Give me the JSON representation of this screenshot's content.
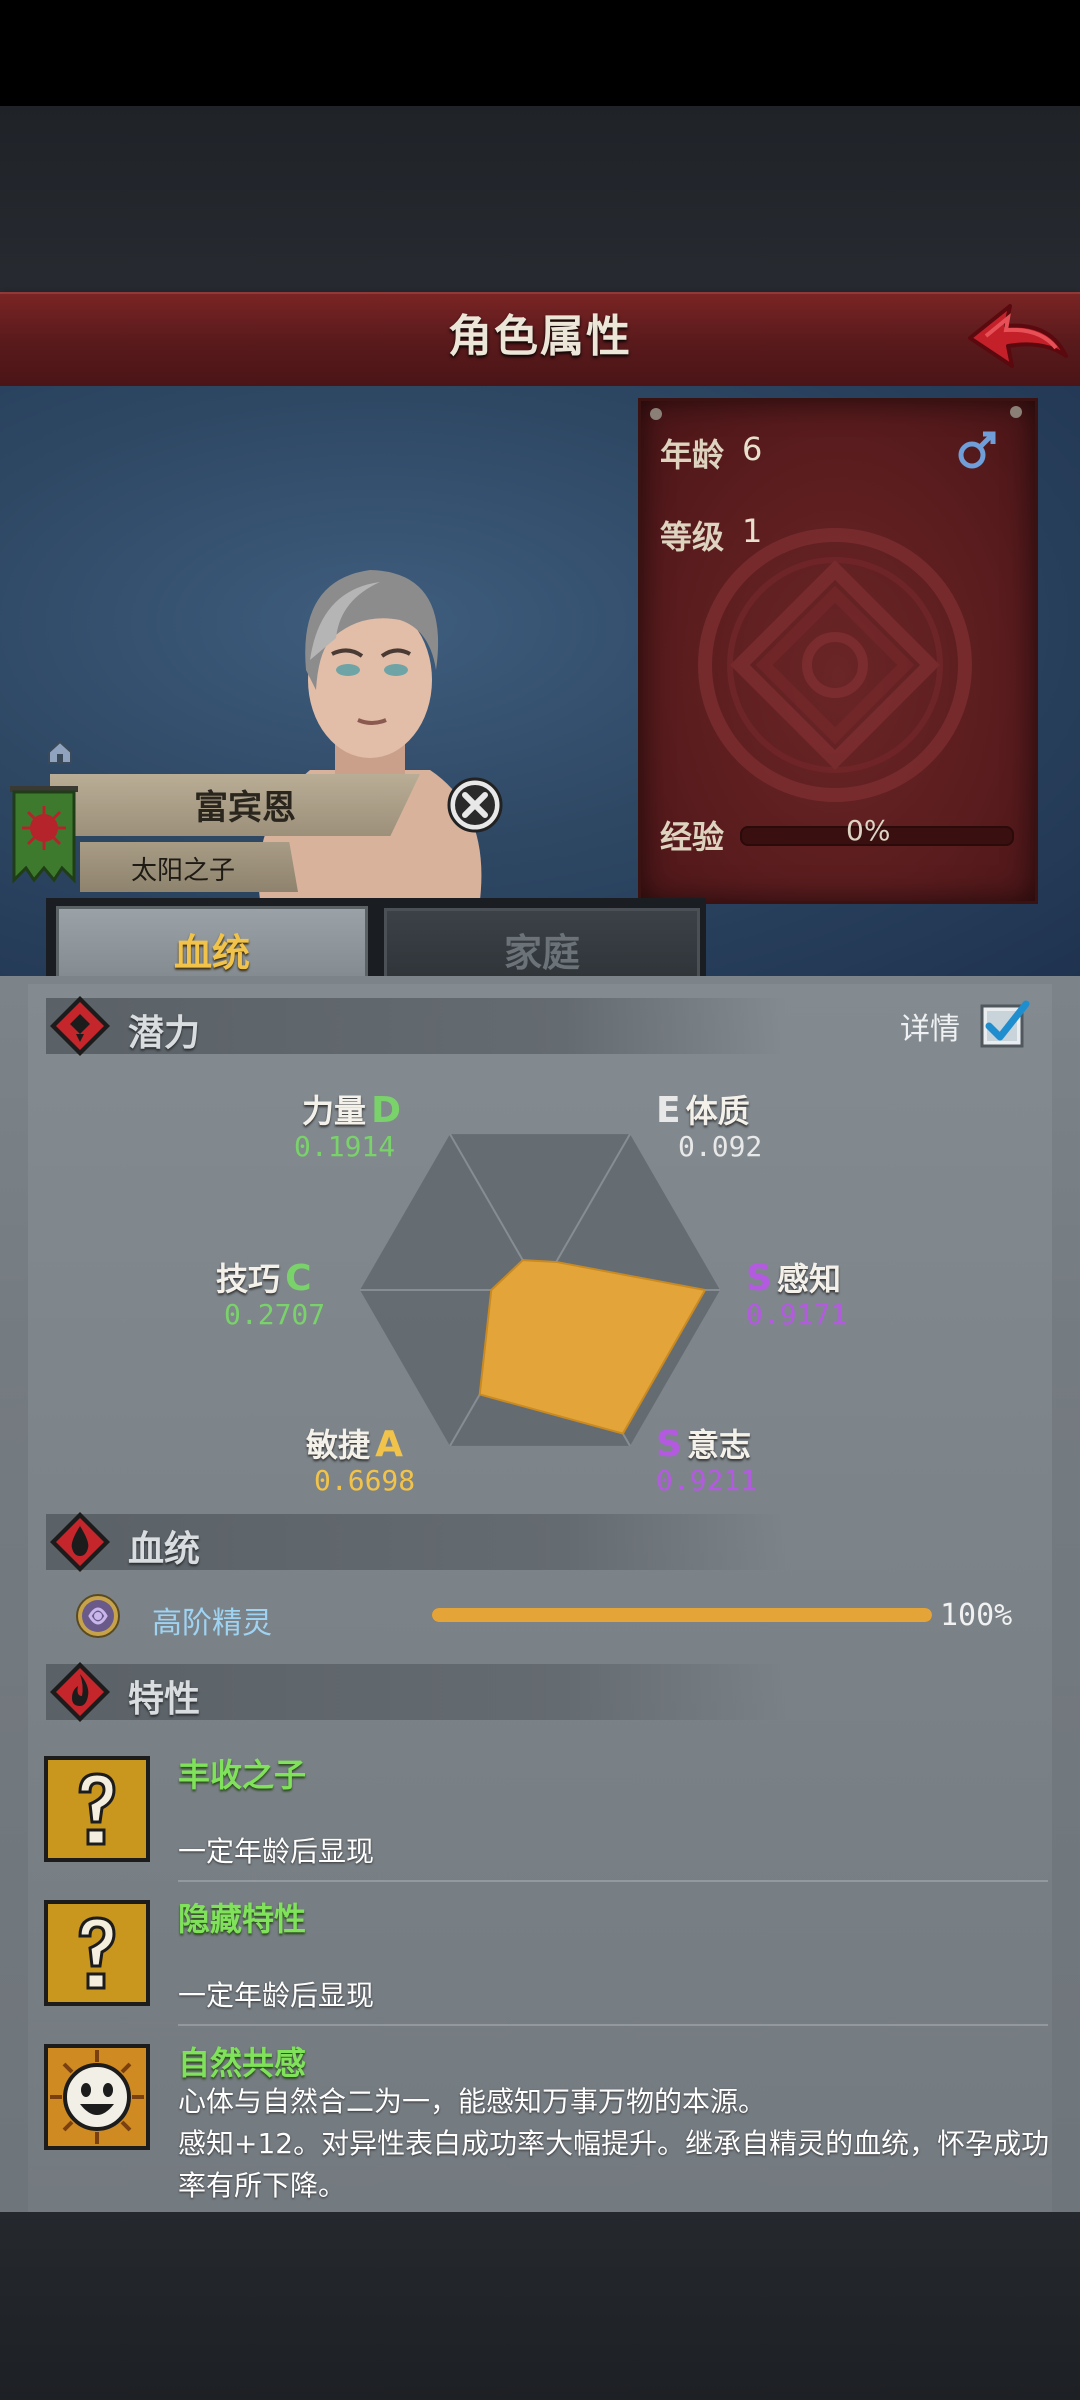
{
  "header": {
    "title": "角色属性"
  },
  "character": {
    "age_label": "年龄",
    "age_value": "6",
    "level_label": "等级",
    "level_value": "1",
    "exp_label": "经验",
    "exp_value": "0%",
    "gender_icon": "male-icon",
    "name": "富宾恩",
    "subtitle": "太阳之子"
  },
  "tabs": [
    {
      "label": "血统",
      "active": true
    },
    {
      "label": "家庭",
      "active": false
    }
  ],
  "potential": {
    "title": "潜力",
    "details_label": "详情",
    "details_checked": true
  },
  "chart_data": {
    "type": "radar",
    "axes": [
      {
        "name": "力量",
        "grade": "D",
        "value": 0.1914,
        "grade_color": "#7ad26a"
      },
      {
        "name": "体质",
        "grade": "E",
        "value": 0.092,
        "grade_color": "#e8e8e8"
      },
      {
        "name": "感知",
        "grade": "S",
        "value": 0.9171,
        "grade_color": "#b45ae0"
      },
      {
        "name": "意志",
        "grade": "S",
        "value": 0.9211,
        "grade_color": "#b45ae0"
      },
      {
        "name": "敏捷",
        "grade": "A",
        "value": 0.6698,
        "grade_color": "#f1c34a"
      },
      {
        "name": "技巧",
        "grade": "C",
        "value": 0.2707,
        "grade_color": "#7ad26a"
      }
    ],
    "fill_color": "#e3a43a",
    "vals_text": [
      "0.1914",
      "0.092",
      "0.9171",
      "0.9211",
      "0.6698",
      "0.2707"
    ]
  },
  "bloodline": {
    "title": "血统",
    "items": [
      {
        "name": "高阶精灵",
        "percent": "100%",
        "fraction": 1.0
      }
    ]
  },
  "traits": {
    "title": "特性",
    "items": [
      {
        "name": "丰收之子",
        "desc": "一定年龄后显现",
        "icon": "question-mark-icon"
      },
      {
        "name": "隐藏特性",
        "desc": "一定年龄后显现",
        "icon": "question-mark-icon"
      },
      {
        "name": "自然共感",
        "desc1": "心体与自然合二为一，能感知万事万物的本源。",
        "desc2": "感知+12。对异性表白成功率大幅提升。继承自精灵的血统，怀孕成功",
        "desc3": "率有所下降。",
        "icon": "smiling-face-icon"
      }
    ]
  }
}
